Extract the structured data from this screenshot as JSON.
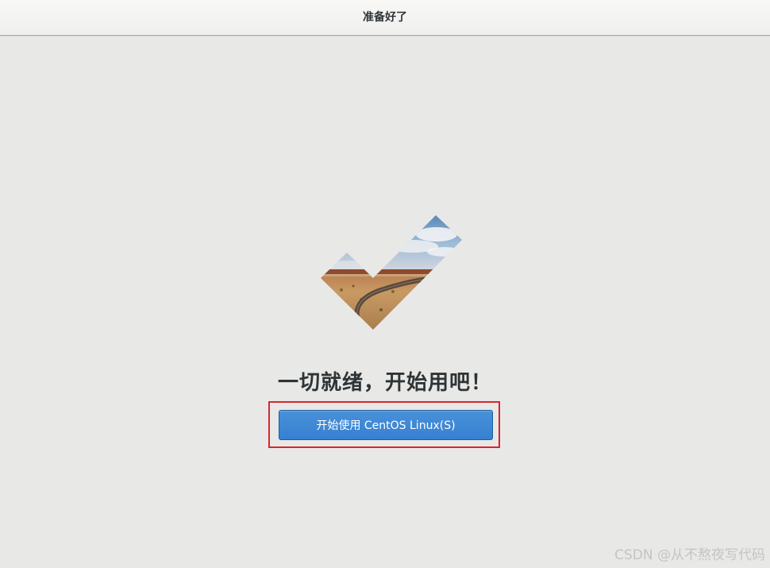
{
  "window": {
    "title": "准备好了"
  },
  "main": {
    "illustration_icon": "checkmark-landscape-icon",
    "headline": "一切就绪，开始用吧！",
    "start_button_label": "开始使用 CentOS Linux(S)"
  },
  "colors": {
    "background": "#e8e8e7",
    "button_blue": "#3a86d6",
    "highlight_red": "#d7262c"
  },
  "watermark": "CSDN @从不熬夜写代码"
}
